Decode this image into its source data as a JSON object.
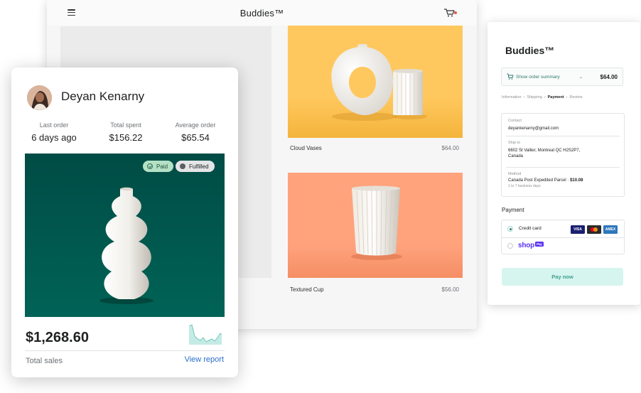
{
  "store": {
    "title": "Buddies™",
    "products": [
      {
        "name": "Cloud Vases",
        "price": "$64.00"
      },
      {
        "name": "Textured Cup",
        "price": "$56.00"
      }
    ]
  },
  "customer": {
    "name": "Deyan Kenarny",
    "stats": [
      {
        "label": "Last order",
        "value": "6 days ago"
      },
      {
        "label": "Total spent",
        "value": "$156.22"
      },
      {
        "label": "Average order",
        "value": "$65.54"
      }
    ],
    "badges": {
      "paid": "Paid",
      "fulfilled": "Fulfilled"
    },
    "total_sales_value": "$1,268.60",
    "total_sales_label": "Total sales",
    "view_report": "View report"
  },
  "checkout": {
    "title": "Buddies™",
    "summary_label": "Show order summary",
    "summary_total": "$64.00",
    "breadcrumbs": [
      "Information",
      "Shipping",
      "Payment",
      "Review"
    ],
    "contact_label": "Contact",
    "contact_value": "deyankenarny@gmail.com",
    "ship_label": "Ship to",
    "ship_value_line1": "6602 St Vallier, Montreal QC  H2S2P7,",
    "ship_value_line2": "Canada",
    "method_label": "Method",
    "method_value": "Canada Post Expedited Parcel · ",
    "method_price": "$10.08",
    "method_sub": "1 to 7 business days",
    "payment_heading": "Payment",
    "credit_card_label": "Credit card",
    "card_brands": {
      "visa": "VISA",
      "amex": "AMEX"
    },
    "shop_logo": "shop",
    "shop_pay_tag": "Pay",
    "pay_now": "Pay now"
  },
  "colors": {
    "hero_green": "#004c45",
    "product1_bg": "#ffc85e",
    "product2_bg": "#ffa37d",
    "link_blue": "#2c6ecb",
    "checkout_accent": "#2c7a6a",
    "shop_purple": "#5a31f4"
  },
  "icons": [
    "menu-icon",
    "cart-icon",
    "paid-check-icon",
    "fulfilled-dot-icon",
    "sparkline-chart",
    "order-summary-cart-icon"
  ]
}
